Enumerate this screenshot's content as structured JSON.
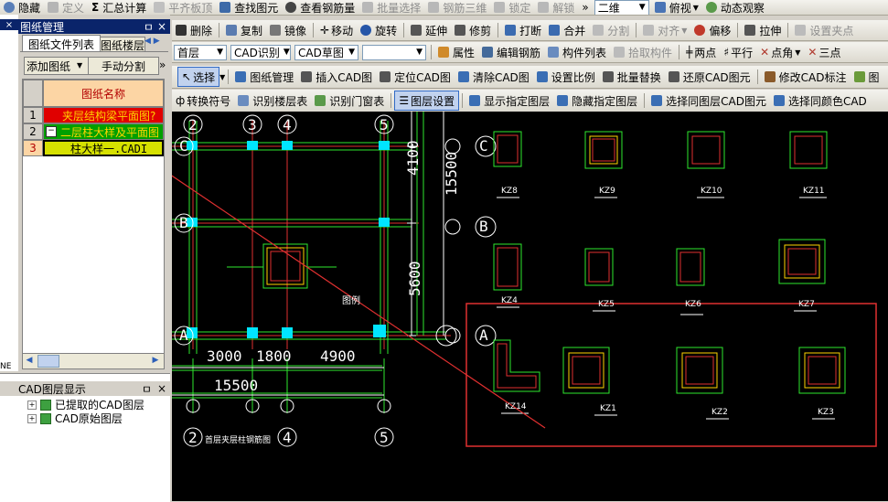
{
  "toolbar_top": {
    "hide": "隐藏",
    "define": "定义",
    "summary": "汇总计算",
    "flush": "平齐板顶",
    "find_element": "查找图元",
    "view_rebar": "查看钢筋量",
    "batch_select": "批量选择",
    "rebar_3d": "钢筋三维",
    "lock": "锁定",
    "unlock": "解锁",
    "more": "»",
    "view_mode": "二维",
    "view_dir": "俯视",
    "dynamic": "动态观察"
  },
  "toolbar_edit": {
    "delete": "删除",
    "copy": "复制",
    "mirror": "镜像",
    "move": "移动",
    "rotate": "旋转",
    "extend": "延伸",
    "trim": "修剪",
    "break": "打断",
    "merge": "合并",
    "split": "分割",
    "align": "对齐",
    "offset": "偏移",
    "stretch": "拉伸",
    "set_grip": "设置夹点"
  },
  "toolbar_mode": {
    "floor": "首层",
    "recognize": "CAD识别",
    "draft": "CAD草图",
    "empty_combo": "",
    "properties": "属性",
    "edit_rebar": "编辑钢筋",
    "component_list": "构件列表",
    "pick_component": "拾取构件",
    "two_point": "两点",
    "parallel": "平行",
    "point_angle": "点角",
    "three_point": "三点"
  },
  "toolbar_cad": {
    "select": "选择",
    "drawing_mgmt": "图纸管理",
    "insert_cad": "插入CAD图",
    "locate_cad": "定位CAD图",
    "clear_cad": "清除CAD图",
    "set_scale": "设置比例",
    "batch_replace": "批量替换",
    "restore_cad": "还原CAD图元",
    "edit_cad_note": "修改CAD标注",
    "more": "图"
  },
  "toolbar_layer": {
    "convert_symbol": "转换符号",
    "recognize_floor_table": "识别楼层表",
    "recognize_window_table": "识别门窗表",
    "layer_setting": "图层设置",
    "show_layer": "显示指定图层",
    "hide_layer": "隐藏指定图层",
    "select_same_layer": "选择同图层CAD图元",
    "select_same_color": "选择同颜色CAD"
  },
  "drawing_panel": {
    "title": "图纸管理",
    "pin": "ㅁ",
    "close": "×",
    "tabs": [
      "图纸文件列表",
      "图纸楼层"
    ],
    "add_drawing": "添加图纸",
    "manual_split": "手动分割",
    "more": "»",
    "column_header": "图纸名称",
    "rows": [
      {
        "num": "1",
        "name": "夹层结构梁平面图?"
      },
      {
        "num": "2",
        "expander": "−",
        "name": "二层柱大样及平面图"
      },
      {
        "num": "3",
        "name": "柱大样一.CADI"
      }
    ]
  },
  "layer_panel": {
    "title": "CAD图层显示",
    "pin": "ㅁ",
    "close": "×",
    "items": [
      "已提取的CAD图层",
      "CAD原始图层"
    ]
  },
  "left_edge": {
    "label": "NE"
  },
  "cad": {
    "axes_top": [
      "2",
      "3",
      "4",
      "5"
    ],
    "axes_bottom": [
      "2",
      "4",
      "5"
    ],
    "row_axes": [
      "C",
      "B",
      "A"
    ],
    "right_row_axes": [
      "C",
      "B",
      "A"
    ],
    "dims_bottom": [
      "3000",
      "1800",
      "4900"
    ],
    "dim_total": "15500",
    "dims_vertical": [
      "4100",
      "15500",
      "5600"
    ],
    "legend_label": "图例",
    "drawing_title": "首层夹层柱钢筋图",
    "columns_row1": [
      "KZ8",
      "KZ9",
      "KZ10",
      "KZ11"
    ],
    "columns_row2": [
      "KZ4",
      "KZ5",
      "KZ6",
      "KZ7"
    ],
    "columns_row3": [
      "KZ14",
      "KZ1",
      "KZ2",
      "KZ3"
    ]
  }
}
